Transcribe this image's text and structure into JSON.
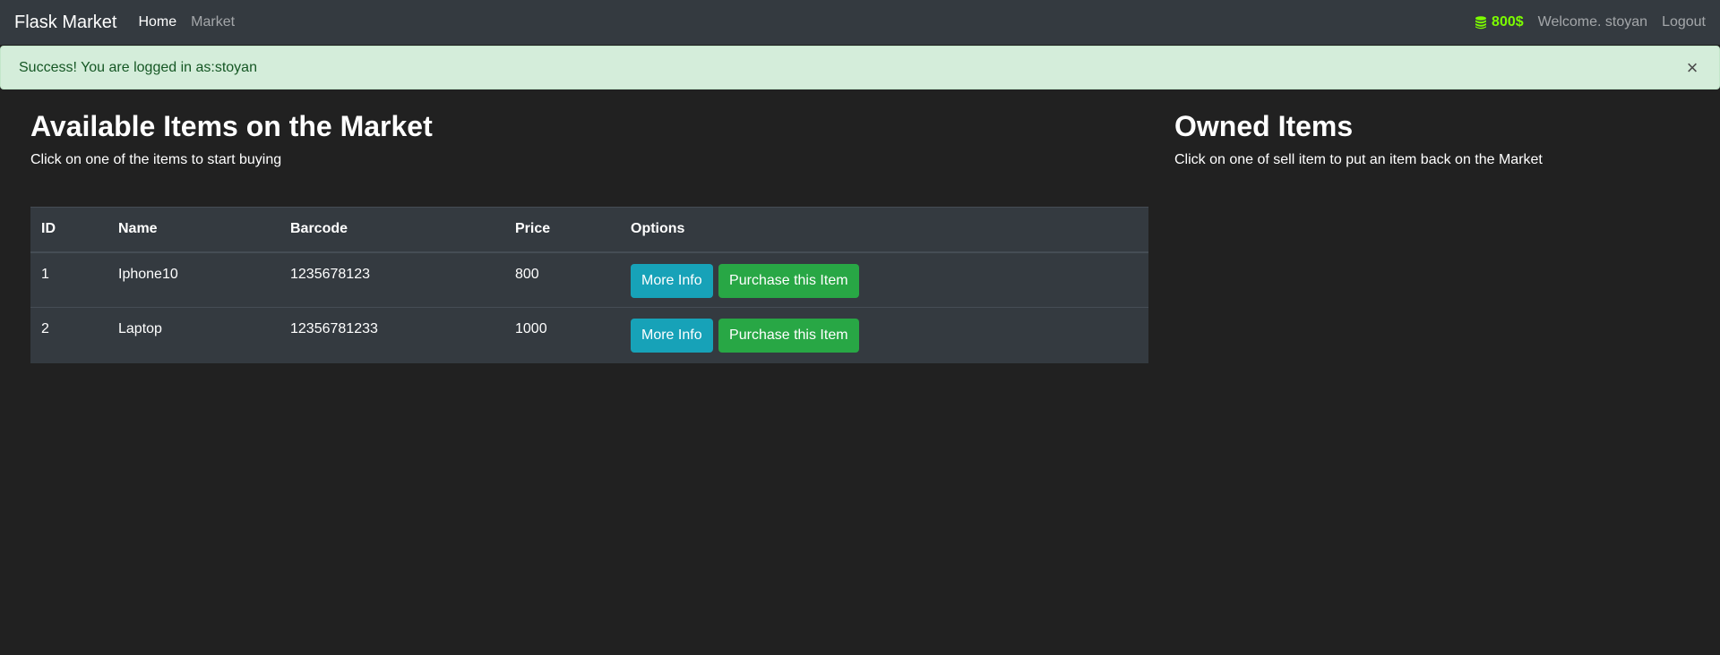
{
  "navbar": {
    "brand": "Flask Market",
    "links": [
      {
        "label": "Home",
        "active": true
      },
      {
        "label": "Market",
        "active": false
      }
    ],
    "budget": "800$",
    "budget_icon": "coins-icon",
    "budget_color": "#7cfc00",
    "welcome": "Welcome. stoyan",
    "logout": "Logout"
  },
  "alert": {
    "message": "Success! You are logged in as:stoyan",
    "close": "×"
  },
  "market": {
    "title": "Available Items on the Market",
    "subtitle": "Click on one of the items to start buying",
    "columns": [
      "ID",
      "Name",
      "Barcode",
      "Price",
      "Options"
    ],
    "rows": [
      {
        "id": "1",
        "name": "Iphone10",
        "barcode": "1235678123",
        "price": "800"
      },
      {
        "id": "2",
        "name": "Laptop",
        "barcode": "12356781233",
        "price": "1000"
      }
    ],
    "more_info_label": "More Info",
    "purchase_label": "Purchase this Item"
  },
  "owned": {
    "title": "Owned Items",
    "subtitle": "Click on one of sell item to put an item back on the Market"
  }
}
